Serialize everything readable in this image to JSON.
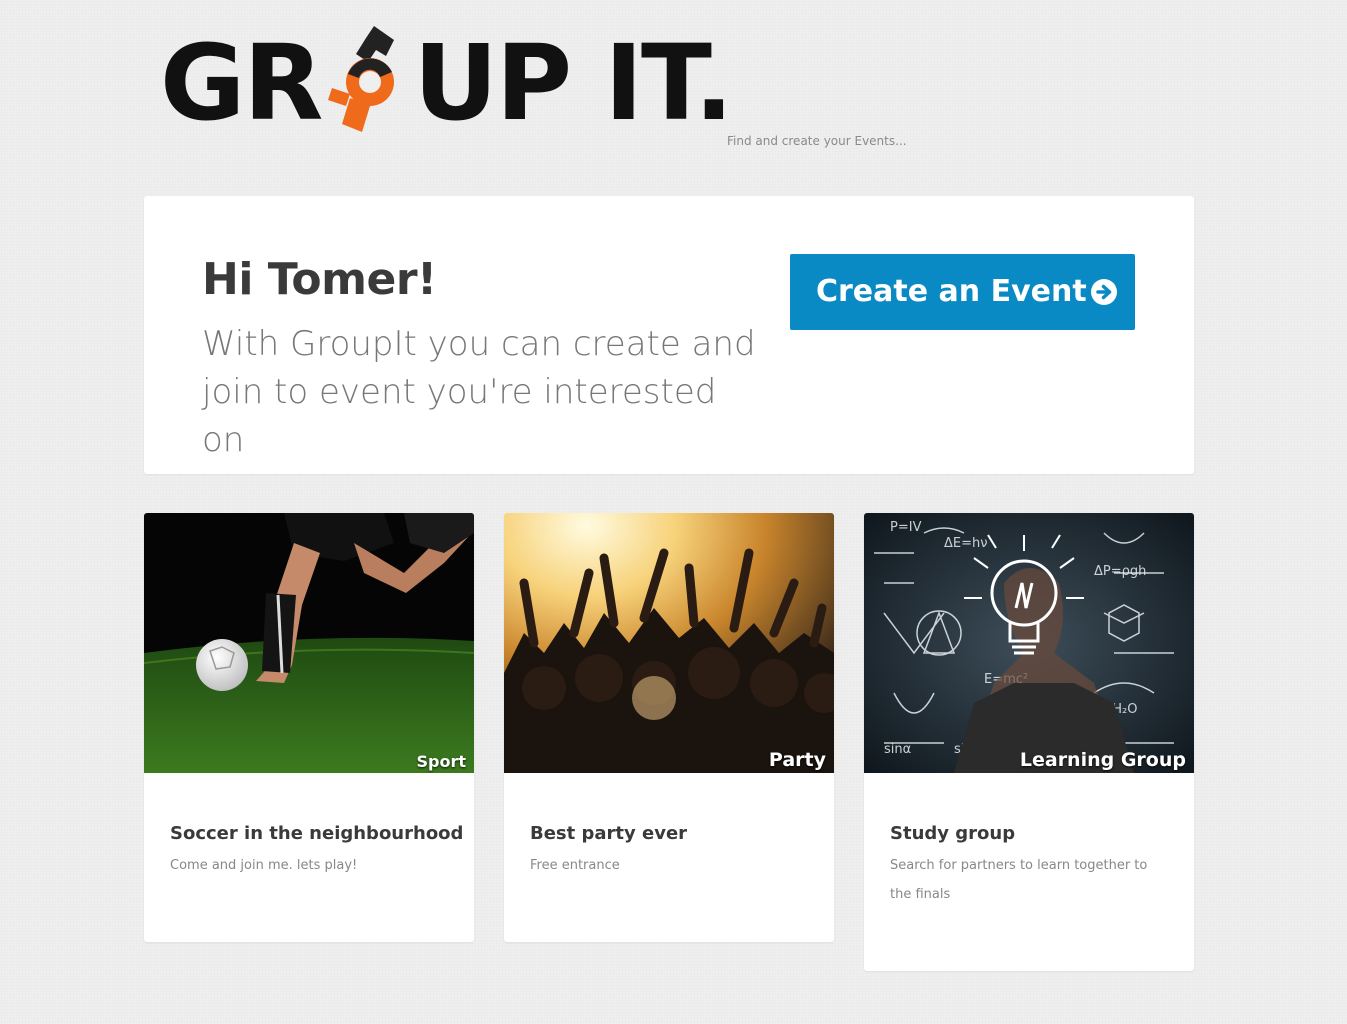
{
  "header": {
    "logo_text_left": "GR",
    "logo_text_right": "UP IT.",
    "logo_icon": "wrench-o-icon",
    "tagline": "Find and create your Events..."
  },
  "hero": {
    "greeting": "Hi Tomer!",
    "subtitle": "With GroupIt you can create and join to event you're interested on",
    "cta_label": "Create an Event",
    "cta_icon": "arrow-circle-right-icon",
    "cta_color": "#0a8ac4"
  },
  "events": [
    {
      "category": "Sport",
      "title": "Soccer in the neighbourhood",
      "description": "Come and join me. lets play!",
      "image": "soccer-image"
    },
    {
      "category": "Party",
      "title": "Best party ever",
      "description": "Free entrance",
      "image": "party-crowd-image"
    },
    {
      "category": "Learning Group",
      "title": "Study group",
      "description": "Search for partners to learn together to the finals",
      "image": "study-lightbulb-image"
    }
  ],
  "colors": {
    "accent": "#0a8ac4",
    "logo_orange": "#ef6a1a",
    "text_dark": "#3a3a3a"
  }
}
